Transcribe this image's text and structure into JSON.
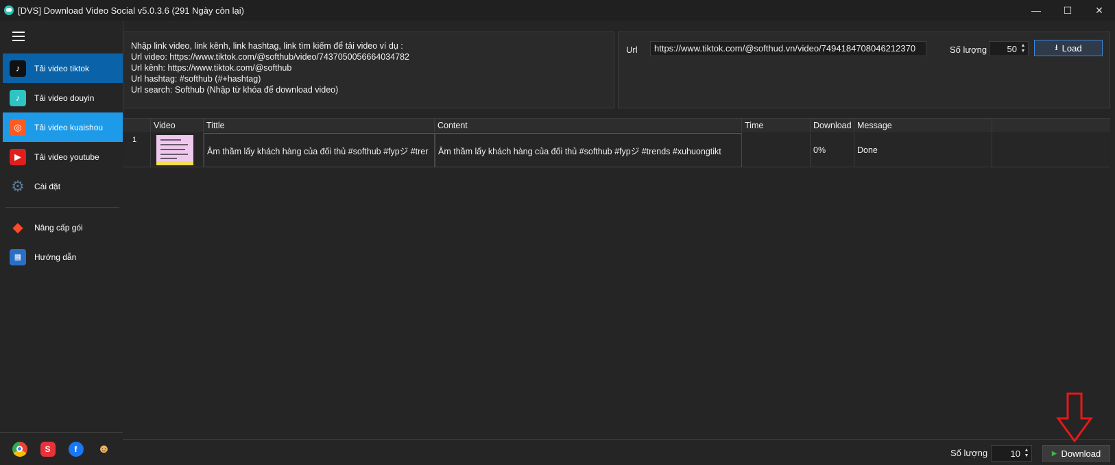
{
  "window": {
    "title": "[DVS] Download Video Social v5.0.3.6 (291 Ngày còn lại)",
    "minimize": "—",
    "maximize": "☐",
    "close": "✕"
  },
  "sidebar": {
    "items": [
      {
        "label": "Tải video tiktok",
        "icon": "tiktok-icon"
      },
      {
        "label": "Tải video douyin",
        "icon": "douyin-icon"
      },
      {
        "label": "Tải video kuaishou",
        "icon": "kuaishou-icon"
      },
      {
        "label": "Tải video youtube",
        "icon": "youtube-icon"
      },
      {
        "label": "Cài đặt",
        "icon": "gear-icon"
      },
      {
        "label": "Nâng cấp gói",
        "icon": "tag-icon"
      },
      {
        "label": "Hướng dẫn",
        "icon": "guide-icon"
      }
    ],
    "social": [
      "chrome-icon",
      "softhub-icon",
      "facebook-icon",
      "support-icon"
    ]
  },
  "hint": {
    "line1": "Nhập link video, link kênh, link hashtag, link tìm kiếm để tải video ví dụ :",
    "line2": "Url video: https://www.tiktok.com/@softhub/video/7437050056664034782",
    "line3": "Url kênh: https://www.tiktok.com/@softhub",
    "line4": "Url hashtag: #softhub (#+hashtag)",
    "line5": "Url search: Softhub (Nhập từ khóa để download video)"
  },
  "url_form": {
    "label": "Url",
    "value": "https://www.tiktok.com/@softhud.vn/video/7494184708046212370",
    "qty_label": "Số lượng",
    "qty_value": "50",
    "load_label": "Load"
  },
  "table": {
    "headers": [
      "Video",
      "Tittle",
      "Content",
      "Time",
      "Download",
      "Message"
    ],
    "rows": [
      {
        "num": "1",
        "title": "Âm thầm lấy khách hàng của đối thủ #softhub #fypジ #trer",
        "content": "Âm thầm lấy khách hàng của đối thủ #softhub #fypジ #trends #xuhuongtikt",
        "time": "",
        "download": "0%",
        "message": "Done"
      }
    ]
  },
  "bottom": {
    "qty_label": "Số lượng",
    "qty_value": "10",
    "download_label": "Download"
  }
}
